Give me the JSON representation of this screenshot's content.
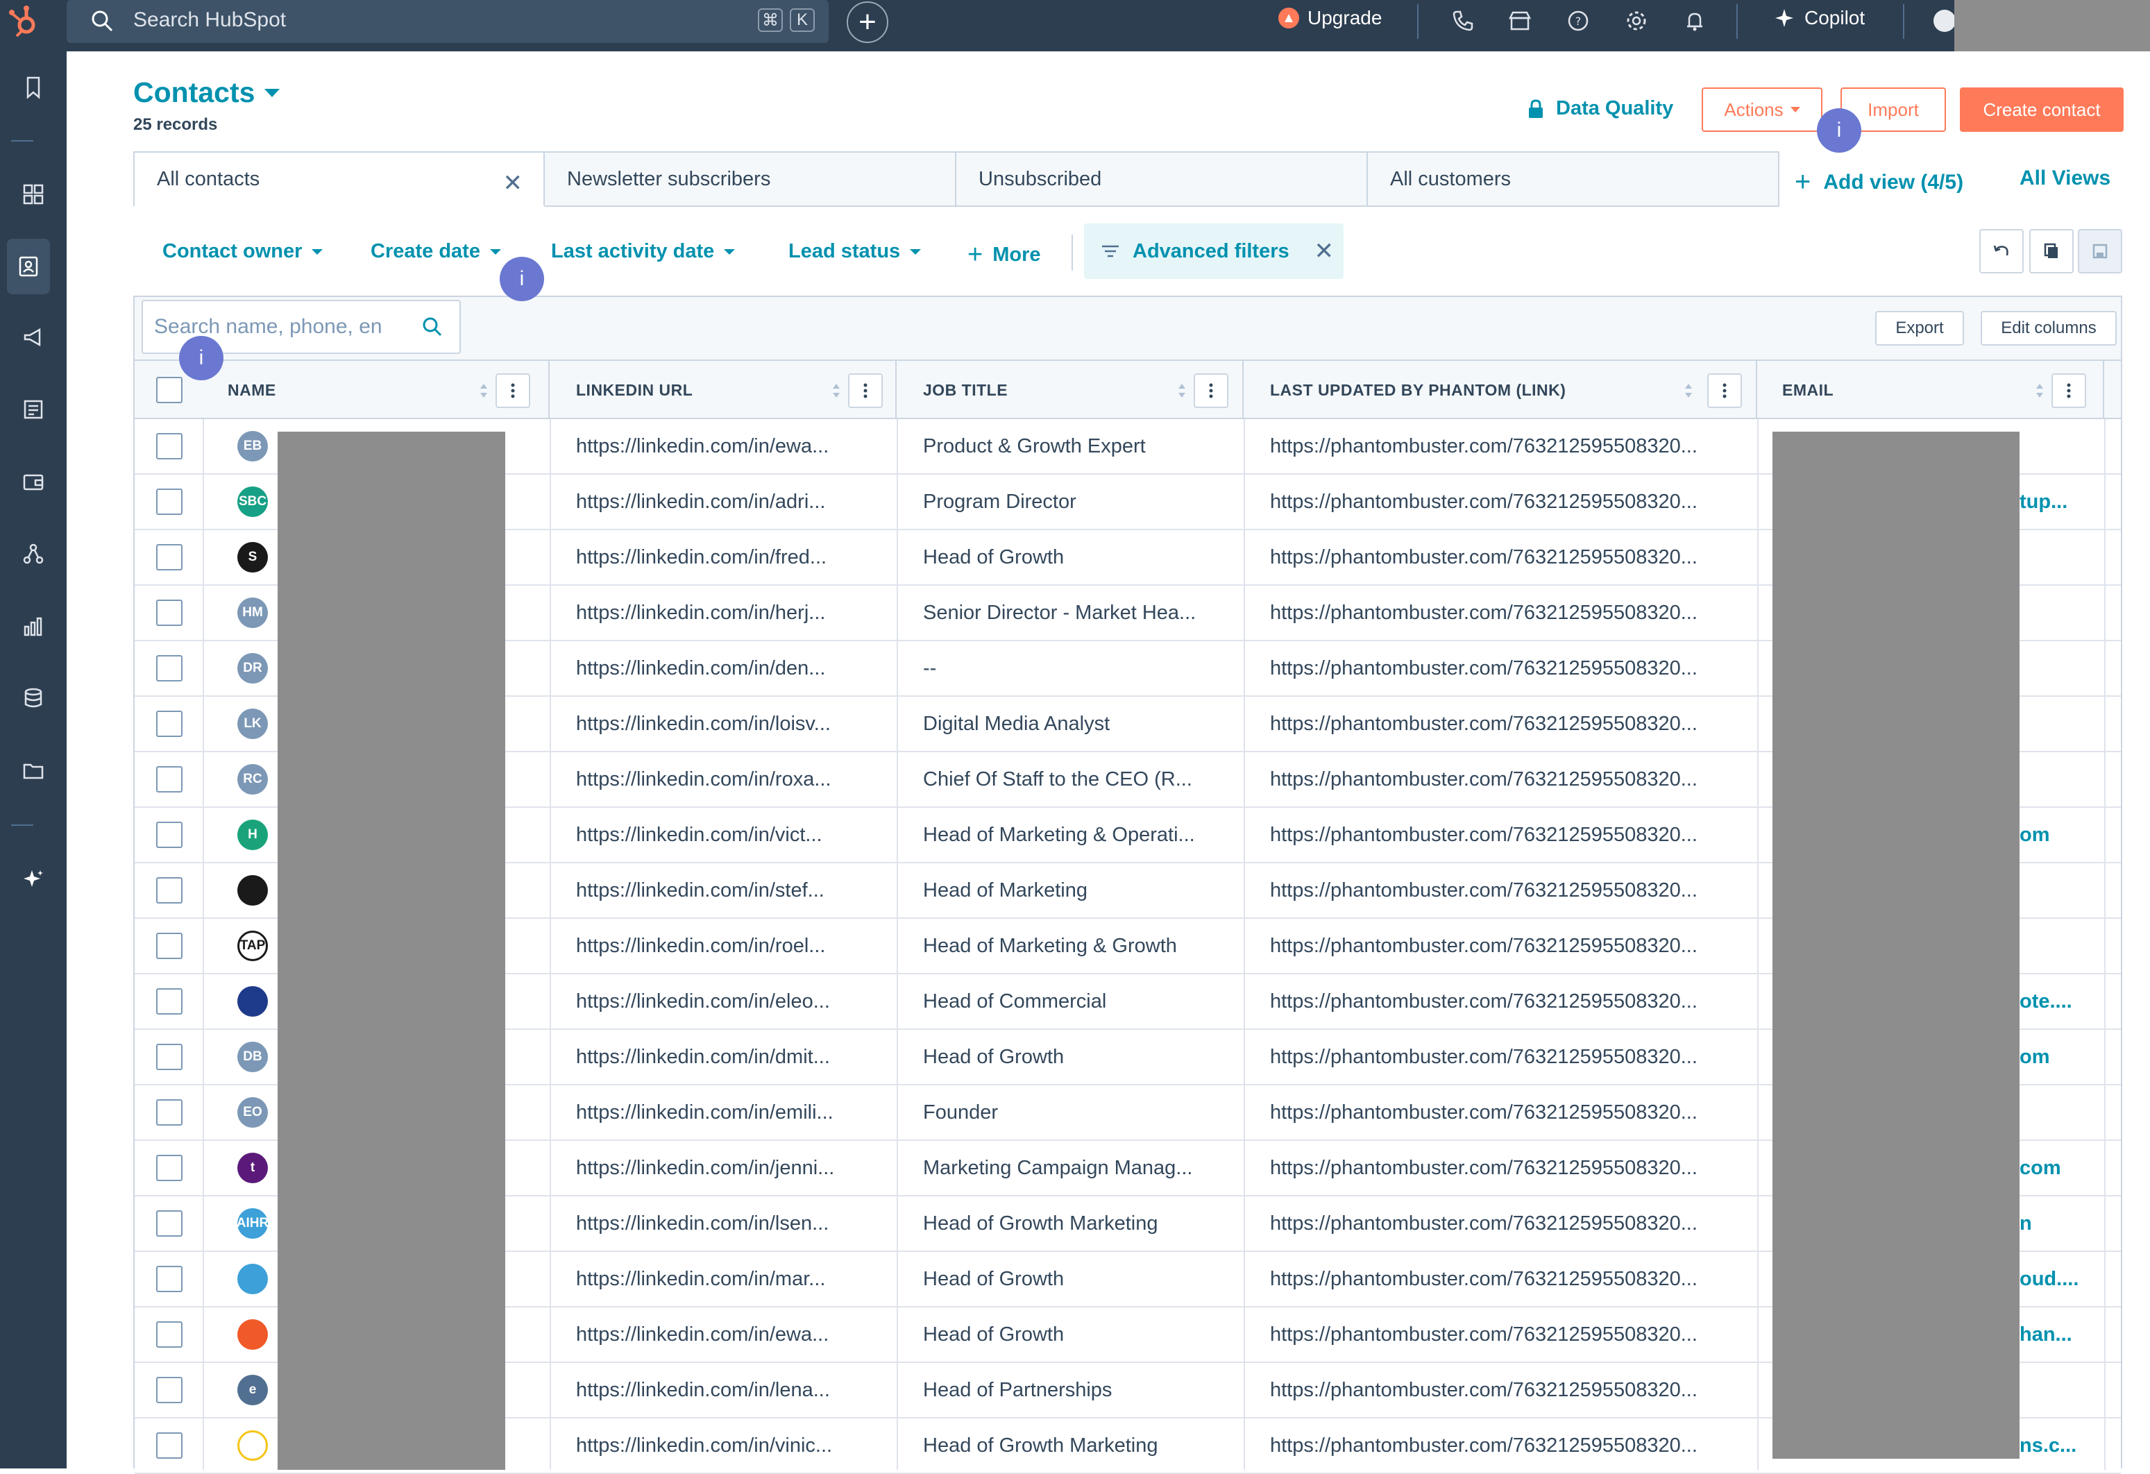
{
  "topbar": {
    "search_placeholder": "Search HubSpot",
    "kbd1": "⌘",
    "kbd2": "K",
    "upgrade": "Upgrade",
    "copilot": "Copilot"
  },
  "page": {
    "title": "Contacts",
    "records": "25 records",
    "data_quality": "Data Quality",
    "actions": "Actions",
    "import": "Import",
    "create": "Create contact"
  },
  "tabs": [
    "All contacts",
    "Newsletter subscribers",
    "Unsubscribed",
    "All customers"
  ],
  "add_view": "Add view (4/5)",
  "all_views": "All Views",
  "filters": {
    "contact_owner": "Contact owner",
    "create_date": "Create date",
    "last_activity": "Last activity date",
    "lead_status": "Lead status",
    "more": "More",
    "advanced": "Advanced filters"
  },
  "tooltip_label": "i",
  "table": {
    "search_placeholder": "Search name, phone, en",
    "export": "Export",
    "edit_columns": "Edit columns",
    "headers": [
      "NAME",
      "LINKEDIN URL",
      "JOB TITLE",
      "LAST UPDATED BY PHANTOM (LINK)",
      "EMAIL"
    ],
    "rows": [
      {
        "avatar": "EB",
        "linkedin": "https://linkedin.com/in/ewa...",
        "job": "Product & Growth Expert",
        "phantom": "https://phantombuster.com/763212595508320...",
        "email": ""
      },
      {
        "avatar": "SBC",
        "linkedin": "https://linkedin.com/in/adri...",
        "job": "Program Director",
        "phantom": "https://phantombuster.com/763212595508320...",
        "email": "tup..."
      },
      {
        "avatar": "S",
        "linkedin": "https://linkedin.com/in/fred...",
        "job": "Head of Growth",
        "phantom": "https://phantombuster.com/763212595508320...",
        "email": ""
      },
      {
        "avatar": "HM",
        "linkedin": "https://linkedin.com/in/herj...",
        "job": "Senior Director - Market Hea...",
        "phantom": "https://phantombuster.com/763212595508320...",
        "email": ""
      },
      {
        "avatar": "DR",
        "linkedin": "https://linkedin.com/in/den...",
        "job": "--",
        "phantom": "https://phantombuster.com/763212595508320...",
        "email": ""
      },
      {
        "avatar": "LK",
        "linkedin": "https://linkedin.com/in/loisv...",
        "job": "Digital Media Analyst",
        "phantom": "https://phantombuster.com/763212595508320...",
        "email": ""
      },
      {
        "avatar": "RC",
        "linkedin": "https://linkedin.com/in/roxa...",
        "job": "Chief Of Staff to the CEO (R...",
        "phantom": "https://phantombuster.com/763212595508320...",
        "email": ""
      },
      {
        "avatar": "H",
        "linkedin": "https://linkedin.com/in/vict...",
        "job": "Head of Marketing & Operati...",
        "phantom": "https://phantombuster.com/763212595508320...",
        "email": "om"
      },
      {
        "avatar": "",
        "linkedin": "https://linkedin.com/in/stef...",
        "job": "Head of Marketing",
        "phantom": "https://phantombuster.com/763212595508320...",
        "email": ""
      },
      {
        "avatar": "TAP",
        "linkedin": "https://linkedin.com/in/roel...",
        "job": "Head of Marketing & Growth",
        "phantom": "https://phantombuster.com/763212595508320...",
        "email": ""
      },
      {
        "avatar": "",
        "linkedin": "https://linkedin.com/in/eleo...",
        "job": "Head of Commercial",
        "phantom": "https://phantombuster.com/763212595508320...",
        "email": "ote...."
      },
      {
        "avatar": "DB",
        "linkedin": "https://linkedin.com/in/dmit...",
        "job": "Head of Growth",
        "phantom": "https://phantombuster.com/763212595508320...",
        "email": "om"
      },
      {
        "avatar": "EO",
        "linkedin": "https://linkedin.com/in/emili...",
        "job": "Founder",
        "phantom": "https://phantombuster.com/763212595508320...",
        "email": ""
      },
      {
        "avatar": "t",
        "linkedin": "https://linkedin.com/in/jenni...",
        "job": "Marketing Campaign Manag...",
        "phantom": "https://phantombuster.com/763212595508320...",
        "email": "com"
      },
      {
        "avatar": "AIHR",
        "linkedin": "https://linkedin.com/in/lsen...",
        "job": "Head of Growth Marketing",
        "phantom": "https://phantombuster.com/763212595508320...",
        "email": "n"
      },
      {
        "avatar": "",
        "linkedin": "https://linkedin.com/in/mar...",
        "job": "Head of Growth",
        "phantom": "https://phantombuster.com/763212595508320...",
        "email": "oud...."
      },
      {
        "avatar": "",
        "linkedin": "https://linkedin.com/in/ewa...",
        "job": "Head of Growth",
        "phantom": "https://phantombuster.com/763212595508320...",
        "email": "han..."
      },
      {
        "avatar": "e",
        "linkedin": "https://linkedin.com/in/lena...",
        "job": "Head of Partnerships",
        "phantom": "https://phantombuster.com/763212595508320...",
        "email": ""
      },
      {
        "avatar": "",
        "linkedin": "https://linkedin.com/in/vinic...",
        "job": "Head of Growth Marketing",
        "phantom": "https://phantombuster.com/763212595508320...",
        "email": "ns.c..."
      }
    ]
  }
}
